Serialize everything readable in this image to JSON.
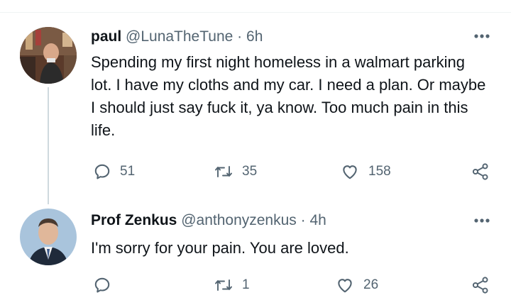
{
  "tweets": [
    {
      "author_name": "paul",
      "handle": "@LunaTheTune",
      "separator": "·",
      "time": "6h",
      "text": "Spending my first night homeless in a walmart parking lot. I have my cloths and my car. I need a plan. Or maybe I should just say fuck it, ya know. Too much pain in this life.",
      "actions": {
        "reply_count": "51",
        "retweet_count": "35",
        "like_count": "158"
      }
    },
    {
      "author_name": "Prof Zenkus",
      "handle": "@anthonyzenkus",
      "separator": "·",
      "time": "4h",
      "text": "I'm sorry for your pain. You are loved.",
      "actions": {
        "reply_count": "",
        "retweet_count": "1",
        "like_count": "26"
      }
    }
  ],
  "icons": {
    "reply": "reply-icon",
    "retweet": "retweet-icon",
    "like": "heart-icon",
    "share": "share-icon",
    "more": "more-options-icon"
  },
  "colors": {
    "text_primary": "#0f1419",
    "text_secondary": "#536471",
    "thread_line": "#cfd9de"
  }
}
